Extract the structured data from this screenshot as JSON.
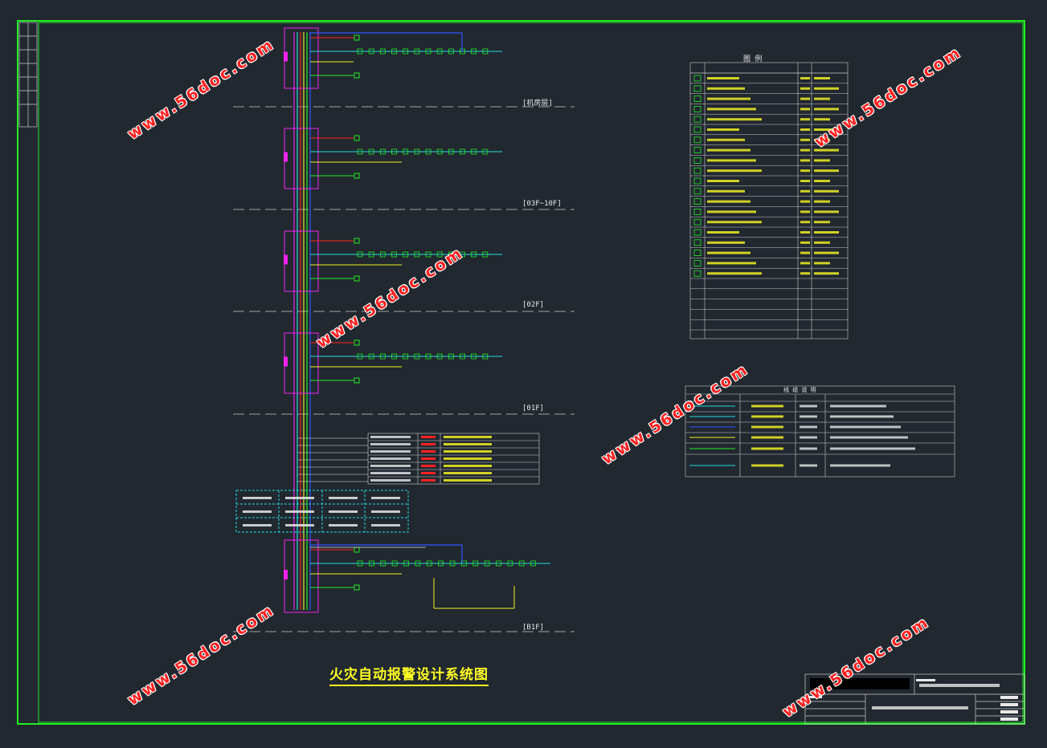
{
  "title": "火灾自动报警设计系统图",
  "watermark": "www.56doc.com",
  "floors": [
    "[机房层]",
    "[03F~10F]",
    "[02F]",
    "[01F]",
    "[B1F]"
  ],
  "legend_title": "图    例",
  "cable_title": "线    缆    说    明",
  "colors": {
    "frame": "#22ee22",
    "red": "#ff2222",
    "cyan": "#22dddd",
    "yellow": "#eeee22",
    "green": "#22ee22",
    "magenta": "#ee22ee",
    "blue": "#3355ff",
    "white": "#e8e8e8"
  }
}
